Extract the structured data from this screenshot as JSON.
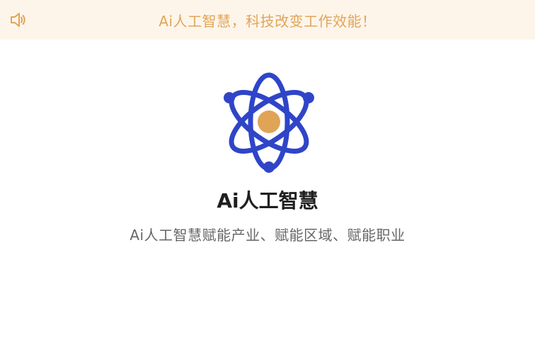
{
  "notice": {
    "text": "Ai人工智慧，科技改变工作效能！"
  },
  "main": {
    "title": "Ai人工智慧",
    "subtitle": "Ai人工智慧赋能产业、赋能区域、赋能职业"
  },
  "icons": {
    "notice_icon": "speaker-icon",
    "logo_icon": "atom-logo-icon"
  },
  "colors": {
    "notice_background": "#fdf5ea",
    "notice_text": "#e0a55a",
    "logo_orbit": "#2f45c8",
    "logo_nucleus": "#e0a457",
    "title_text": "#1f1f1f",
    "subtitle_text": "#666666"
  }
}
